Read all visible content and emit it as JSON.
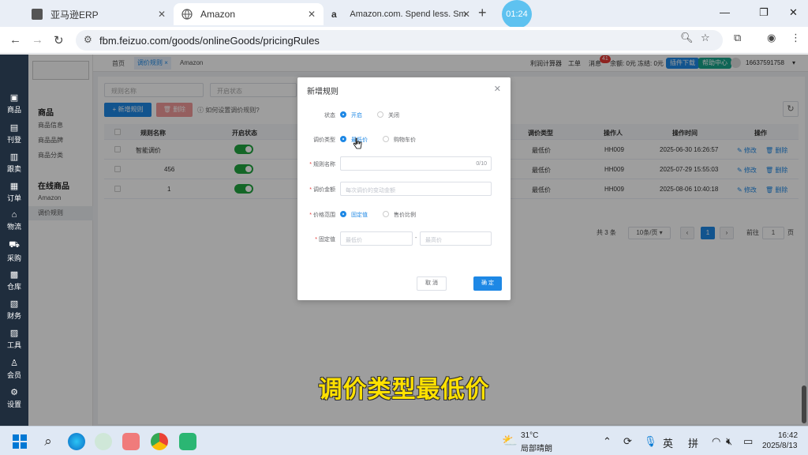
{
  "browser": {
    "tabs": [
      {
        "title": "亚马逊ERP"
      },
      {
        "title": "Amazon"
      },
      {
        "title": "Amazon.com. Spend less. Sm"
      }
    ],
    "timer": "01:24",
    "url": "fbm.feizuo.com/goods/onlineGoods/pricingRules"
  },
  "sidebar": {
    "items": [
      {
        "label": "商品",
        "icon": "box-icon"
      },
      {
        "label": "刊登",
        "icon": "publish-icon"
      },
      {
        "label": "跟卖",
        "icon": "follow-icon"
      },
      {
        "label": "订单",
        "icon": "order-icon"
      },
      {
        "label": "物流",
        "icon": "logistics-icon"
      },
      {
        "label": "采购",
        "icon": "cart-icon"
      },
      {
        "label": "仓库",
        "icon": "warehouse-icon"
      },
      {
        "label": "财务",
        "icon": "finance-icon"
      },
      {
        "label": "工具",
        "icon": "tools-icon"
      },
      {
        "label": "会员",
        "icon": "member-icon"
      },
      {
        "label": "设置",
        "icon": "settings-icon"
      }
    ]
  },
  "submenu": {
    "group1": "商品",
    "group1_items": [
      "商品信息",
      "商品品牌",
      "商品分类"
    ],
    "group2": "在线商品",
    "group2_items": [
      "Amazon",
      "调价规则"
    ]
  },
  "topnav": {
    "tabs": [
      "首页",
      "调价规则",
      "Amazon"
    ],
    "tab_close": "×",
    "calculator": "利润计算器",
    "ticket": "工单",
    "messages": "消息",
    "message_count": "41",
    "balance": "余额: 0元",
    "frozen": "冻结: 0元",
    "plugin_download": "插件下载",
    "help_center": "帮助中心",
    "phone": "16637591758"
  },
  "toolbar": {
    "filter_name_placeholder": "规则名称",
    "filter_status_placeholder": "开启状态",
    "add_label": "+ 新增规则",
    "delete_label": "删除",
    "help_text": "如何设置调价规则?"
  },
  "table": {
    "headers": [
      "规则名称",
      "开启状态",
      "调价类型",
      "操作人",
      "操作时间",
      "操作"
    ],
    "rows": [
      {
        "name": "智能调价",
        "type": "最低价",
        "operator": "HH009",
        "time": "2025-06-30 16:26:57"
      },
      {
        "name": "456",
        "type": "最低价",
        "operator": "HH009",
        "time": "2025-07-29 15:55:03"
      },
      {
        "name": "1",
        "type": "最低价",
        "operator": "HH009",
        "time": "2025-08-06 10:40:18"
      }
    ],
    "edit_label": "修改",
    "delete_label": "删除"
  },
  "pagination": {
    "total": "共 3 条",
    "page_size": "10条/页",
    "current_page": "1",
    "goto_label": "前往",
    "goto_value": "1",
    "page_suffix": "页"
  },
  "modal": {
    "title": "新增规则",
    "status_label": "状态",
    "status_on": "开启",
    "status_off": "关闭",
    "type_label": "调价类型",
    "type_lowest": "最低价",
    "type_buybox": "购物车价",
    "name_label": "规则名称",
    "name_counter": "0/10",
    "amount_label": "调价金额",
    "amount_placeholder": "每次调价的变动金额",
    "range_label": "价格范围",
    "range_fixed": "固定值",
    "range_ratio": "售价比例",
    "fixed_label": "固定值",
    "min_placeholder": "最低价",
    "range_sep": "-",
    "max_placeholder": "最高价",
    "cancel": "取 消",
    "ok": "确 定"
  },
  "caption": "调价类型最低价",
  "taskbar": {
    "temperature": "31°C",
    "weather": "局部晴朗",
    "ime1": "英",
    "ime2": "拼",
    "time": "16:42",
    "date": "2025/8/13"
  },
  "colors": {
    "primary": "#1e88e5",
    "sidebar": "#1f2d3d",
    "switch_on": "#21a53f",
    "caption": "#ffe100"
  }
}
